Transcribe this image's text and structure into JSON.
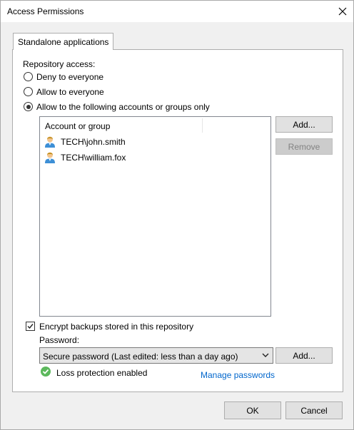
{
  "window": {
    "title": "Access Permissions",
    "close_icon": "close-icon"
  },
  "tab": {
    "label": "Standalone applications"
  },
  "repository_access": {
    "label": "Repository access:",
    "options": [
      {
        "label": "Deny to everyone",
        "checked": false
      },
      {
        "label": "Allow to everyone",
        "checked": false
      },
      {
        "label": "Allow to the following accounts or groups only",
        "checked": true
      }
    ]
  },
  "accounts": {
    "column_header": "Account or group",
    "items": [
      {
        "name": "TECH\\john.smith",
        "icon": "user-icon"
      },
      {
        "name": "TECH\\william.fox",
        "icon": "user-icon"
      }
    ],
    "add_label": "Add...",
    "remove_label": "Remove"
  },
  "encryption": {
    "checkbox_label": "Encrypt backups stored in this repository",
    "checked": true,
    "password_label": "Password:",
    "password_selected": "Secure password (Last edited: less than a day ago)",
    "add_label": "Add...",
    "status_text": "Loss protection enabled",
    "status_icon": "check-circle-icon",
    "status_color": "#5cb85c",
    "manage_link": "Manage passwords"
  },
  "footer": {
    "ok_label": "OK",
    "cancel_label": "Cancel"
  }
}
